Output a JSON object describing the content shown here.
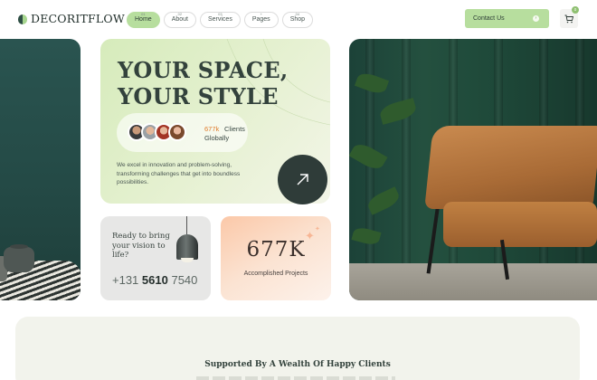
{
  "header": {
    "logo_text": "DECORITFLOW",
    "nav": [
      {
        "label": "Home",
        "num": "01",
        "active": true
      },
      {
        "label": "About",
        "num": "02",
        "active": false
      },
      {
        "label": "Services",
        "num": "03",
        "active": false
      },
      {
        "label": "Pages",
        "num": "+",
        "active": false
      },
      {
        "label": "Shop",
        "num": "04",
        "active": false
      }
    ],
    "contact_label": "Contact Us",
    "contact_icon": "arrow-right-icon",
    "cart_count": "0",
    "cart_icon": "cart-icon"
  },
  "hero": {
    "title_line1": "YOUR SPACE,",
    "title_line2": "YOUR STYLE",
    "clients_count": "677k",
    "clients_label": "Clients",
    "clients_sub": "Globally",
    "description": "We excel in innovation and problem-solving, transforming challenges that get into boundless possibilities.",
    "arrow_icon": "arrow-up-right-icon"
  },
  "call_card": {
    "text": "Ready to bring your vision to life?",
    "phone_prefix": "+131",
    "phone_bold": "5610",
    "phone_suffix": "7540"
  },
  "stat_card": {
    "number": "677K",
    "label": "Accomplished Projects"
  },
  "clients_section": {
    "heading": "Supported By A Wealth Of Happy Clients"
  },
  "colors": {
    "accent_green": "#b7de9e",
    "dark": "#2f3c39",
    "highlight_orange": "#e07a2a",
    "peach": "#fbc8a8"
  }
}
